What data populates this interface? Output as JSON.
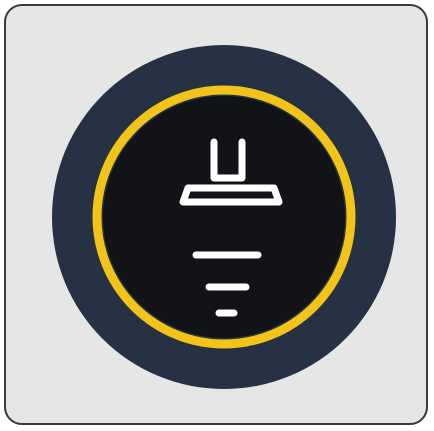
{
  "tile": {
    "background": "#e6e6e7",
    "border": "#3a3a3a"
  },
  "icon": {
    "name": "ceiling-lamp-icon",
    "outer_ring_color": "#263144",
    "accent_ring_color": "#f2c318",
    "center_color": "#121317",
    "glyph_color": "#ffffff"
  }
}
